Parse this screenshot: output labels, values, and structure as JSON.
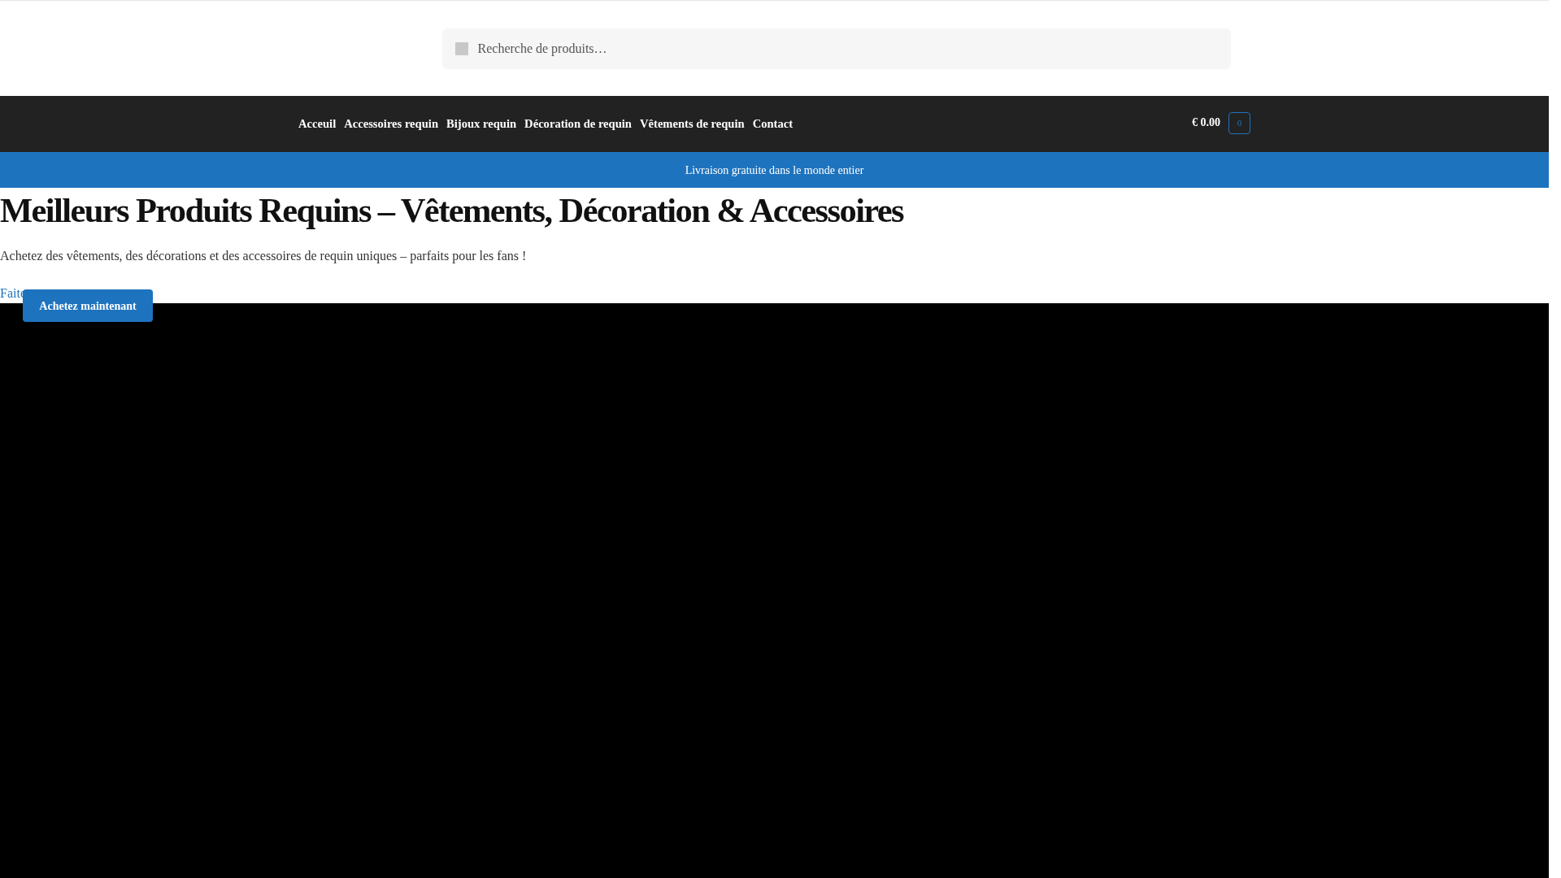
{
  "search": {
    "placeholder": "Recherche de produits…"
  },
  "nav": {
    "items": [
      {
        "label": "Acceuil"
      },
      {
        "label": "Accessoires requin"
      },
      {
        "label": "Bijoux requin"
      },
      {
        "label": "Décoration de requin"
      },
      {
        "label": "Vêtements de requin"
      },
      {
        "label": "Contact"
      }
    ]
  },
  "cart": {
    "total": "€ 0.00",
    "count": "0"
  },
  "banner": {
    "text": "Livraison gratuite dans le monde entier"
  },
  "hero": {
    "title": "Meilleurs Produits Requins – Vêtements, Décoration & Accessoires",
    "subtitle": "Achetez des vêtements, des décorations et des accessoires de requin uniques – parfaits pour les fans !",
    "link": "Faite",
    "button": "Achetez maintenant"
  }
}
